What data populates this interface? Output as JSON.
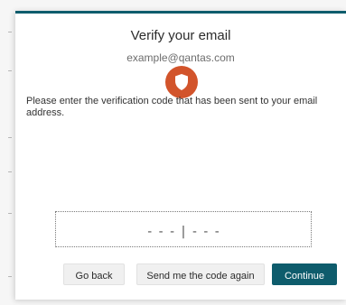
{
  "dialog": {
    "title": "Verify your email",
    "email": "example@qantas.com",
    "instructions": "Please enter the verification code that has been sent to your email address.",
    "accent_color": "#0e5c6c",
    "icon": "shield-icon",
    "icon_color": "#d2542b"
  },
  "code_input": {
    "placeholder": "---|---",
    "value": ""
  },
  "buttons": {
    "back_label": "Go back",
    "resend_label": "Send me the code again",
    "continue_label": "Continue"
  }
}
